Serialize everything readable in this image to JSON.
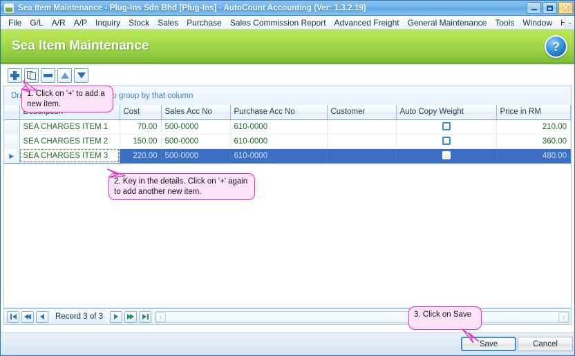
{
  "window": {
    "title": "Sea Item Maintenance - Plug-Ins Sdn Bhd [Plug-Ins] - AutoCount Accounting (Ver: 1.3.2.19)",
    "icon": "app-icon",
    "minimize_label": "–",
    "maximize_label": "□",
    "close_label": "✕"
  },
  "menu": {
    "items": [
      {
        "label": "File"
      },
      {
        "label": "G/L"
      },
      {
        "label": "A/R"
      },
      {
        "label": "A/P"
      },
      {
        "label": "Inquiry"
      },
      {
        "label": "Stock"
      },
      {
        "label": "Sales"
      },
      {
        "label": "Purchase"
      },
      {
        "label": "Sales Commission Report"
      },
      {
        "label": "Advanced Freight"
      },
      {
        "label": "General Maintenance"
      },
      {
        "label": "Tools"
      },
      {
        "label": "Window"
      },
      {
        "label": "Help"
      }
    ],
    "overflow_label": "⌄"
  },
  "banner": {
    "title": "Sea Item Maintenance",
    "help_label": "?",
    "color_top": "#bbe755",
    "color_bottom": "#7bb937",
    "help_color": "#2b7fc4"
  },
  "toolbar": {
    "buttons": [
      {
        "name": "add-button",
        "icon": "plus-icon"
      },
      {
        "name": "duplicate-button",
        "icon": "copy-icon"
      },
      {
        "name": "delete-button",
        "icon": "minus-icon"
      },
      {
        "name": "move-up-button",
        "icon": "arrow-up-icon"
      },
      {
        "name": "move-down-button",
        "icon": "arrow-down-icon"
      }
    ]
  },
  "group_panel": {
    "hint": "Drag a column header here to group by that column"
  },
  "grid": {
    "columns": [
      "Description",
      "Cost",
      "Sales Acc No",
      "Purchase Acc No",
      "Customer",
      "Auto Copy Weight",
      "Price in RM"
    ],
    "rows": [
      {
        "indicator": "",
        "description": "SEA CHARGES ITEM 1",
        "cost": "70.00",
        "sales_acc_no": "500-0000",
        "purchase_acc_no": "610-0000",
        "customer": "",
        "auto_copy_weight": false,
        "price_in_rm": "210.00",
        "selected": false
      },
      {
        "indicator": "",
        "description": "SEA CHARGES ITEM 2",
        "cost": "150.00",
        "sales_acc_no": "500-0000",
        "purchase_acc_no": "610-0000",
        "customer": "",
        "auto_copy_weight": false,
        "price_in_rm": "360.00",
        "selected": false
      },
      {
        "indicator": "▶",
        "description": "SEA CHARGES ITEM 3",
        "cost": "220.00",
        "sales_acc_no": "500-0000",
        "purchase_acc_no": "610-0000",
        "customer": "",
        "auto_copy_weight": false,
        "price_in_rm": "480.00",
        "selected": true
      }
    ],
    "selection_color": "#3a6fc4",
    "text_color": "#1d6b2a"
  },
  "navigator": {
    "first_label": "⏮",
    "prev_page_label": "⏪",
    "prev_label": "◀",
    "record_label": "Record 3 of 3",
    "next_label": "▶",
    "next_page_label": "⏩",
    "last_label": "⏭",
    "scroll_left_label": "‹",
    "scroll_right_label": "›"
  },
  "footer": {
    "save_label": "Save",
    "cancel_label": "Cancel"
  },
  "callouts": [
    {
      "text": "1. Click on '+' to add a new item."
    },
    {
      "text": "2. Key in the details. Click on '+' again to add another new item."
    },
    {
      "text": "3. Click on Save"
    }
  ]
}
